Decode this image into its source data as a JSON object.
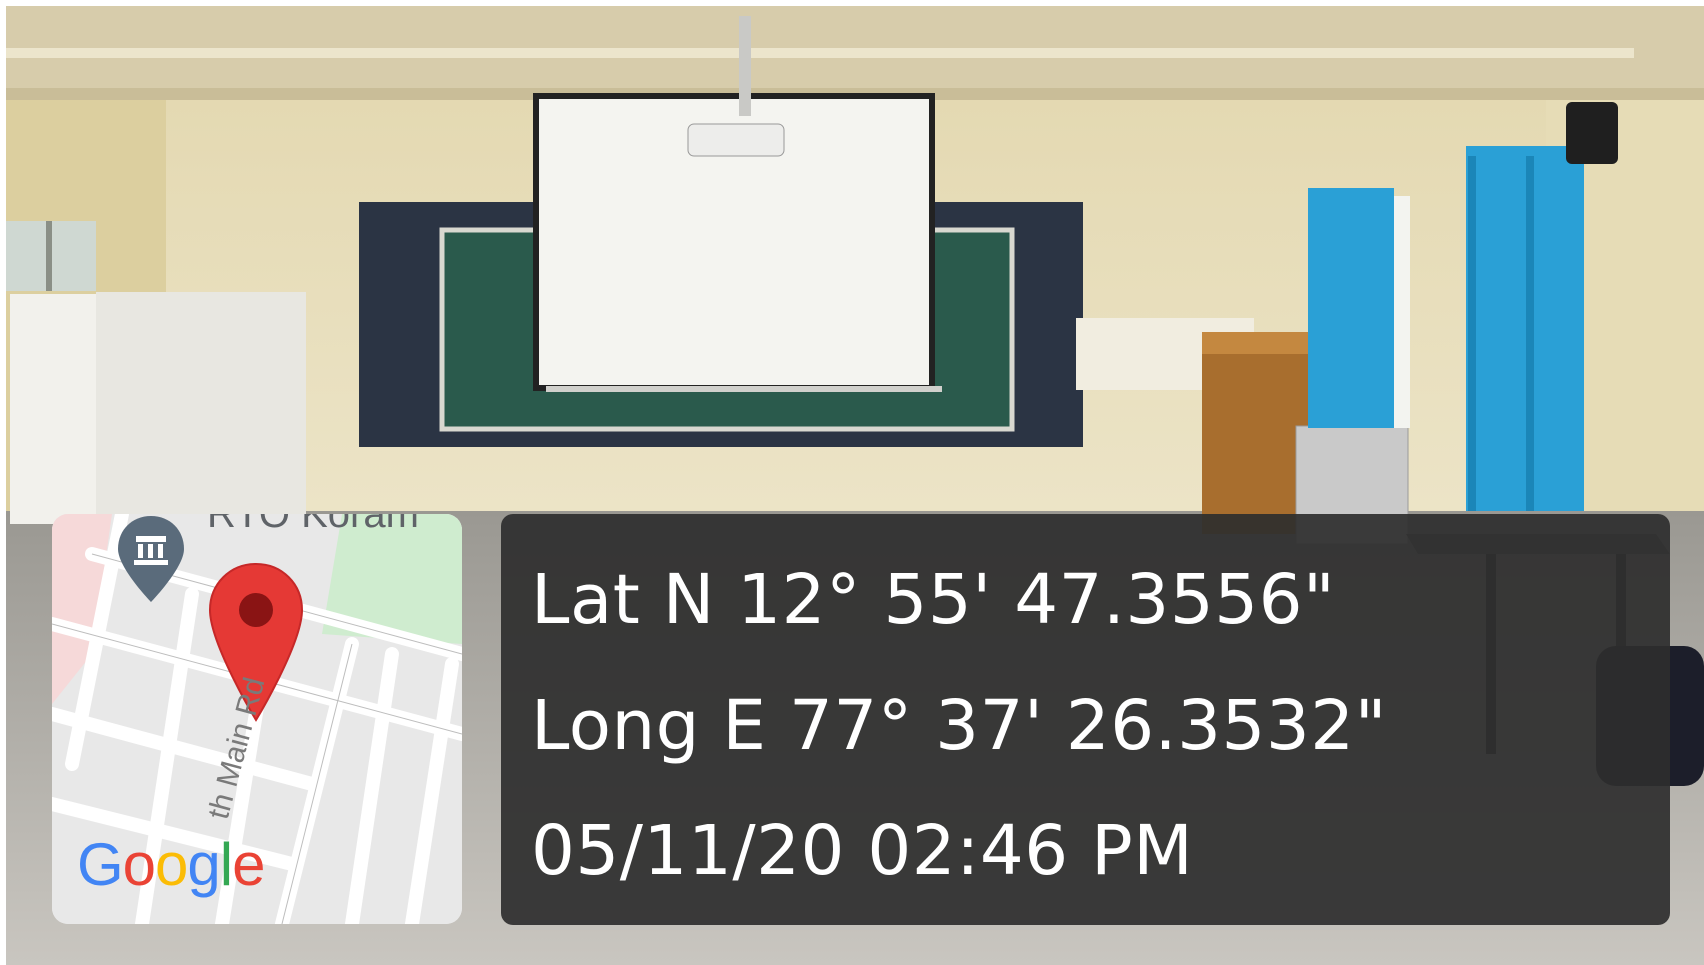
{
  "overlay": {
    "latitude": "Lat N 12° 55' 47.3556\"",
    "longitude": "Long E 77° 37' 26.3532\"",
    "datetime": "05/11/20 02:46 PM"
  },
  "map": {
    "poi_label": "RTO Koram",
    "road_label": "th Main Rd",
    "logo": {
      "letters": [
        "G",
        "o",
        "o",
        "g",
        "l",
        "e"
      ],
      "colors": [
        "#4285F4",
        "#EA4335",
        "#FBBC05",
        "#4285F4",
        "#34A853",
        "#EA4335"
      ]
    },
    "pin_color": "#E53935",
    "poi_icon": "building-icon"
  },
  "colors": {
    "wall": "#E9DFB8",
    "curtain": "#2FA0D6",
    "chalkboard": "#1E5C50",
    "panel": "#2E2E2E"
  }
}
